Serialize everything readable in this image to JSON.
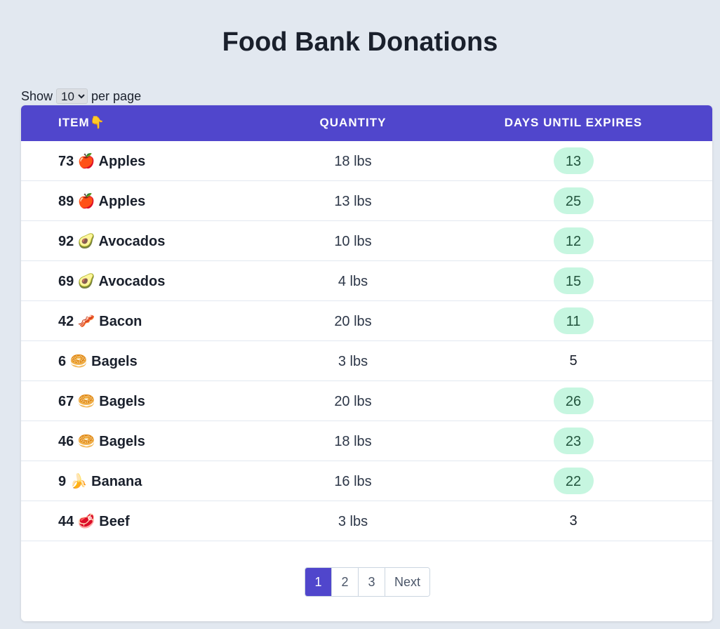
{
  "page": {
    "title": "Food Bank Donations"
  },
  "per_page": {
    "prefix": "Show",
    "selected": "10",
    "suffix": "per page"
  },
  "table": {
    "headers": {
      "item": "ITEM👇",
      "quantity": "QUANTITY",
      "days": "DAYS UNTIL EXPIRES"
    },
    "rows": [
      {
        "item": "73 🍎 Apples",
        "quantity": "18 lbs",
        "days": "13",
        "badge": true
      },
      {
        "item": "89 🍎 Apples",
        "quantity": "13 lbs",
        "days": "25",
        "badge": true
      },
      {
        "item": "92 🥑 Avocados",
        "quantity": "10 lbs",
        "days": "12",
        "badge": true
      },
      {
        "item": "69 🥑 Avocados",
        "quantity": "4 lbs",
        "days": "15",
        "badge": true
      },
      {
        "item": "42 🥓 Bacon",
        "quantity": "20 lbs",
        "days": "11",
        "badge": true
      },
      {
        "item": "6 🥯 Bagels",
        "quantity": "3 lbs",
        "days": "5",
        "badge": false
      },
      {
        "item": "67 🥯 Bagels",
        "quantity": "20 lbs",
        "days": "26",
        "badge": true
      },
      {
        "item": "46 🥯 Bagels",
        "quantity": "18 lbs",
        "days": "23",
        "badge": true
      },
      {
        "item": "9 🍌 Banana",
        "quantity": "16 lbs",
        "days": "22",
        "badge": true
      },
      {
        "item": "44 🥩 Beef",
        "quantity": "3 lbs",
        "days": "3",
        "badge": false
      }
    ]
  },
  "pagination": {
    "pages": [
      "1",
      "2",
      "3"
    ],
    "active": "1",
    "next_label": "Next"
  },
  "colors": {
    "header_bg": "#5046cc",
    "badge_bg": "#c6f6e0",
    "badge_text": "#22543d",
    "page_bg": "#e2e8f0"
  }
}
